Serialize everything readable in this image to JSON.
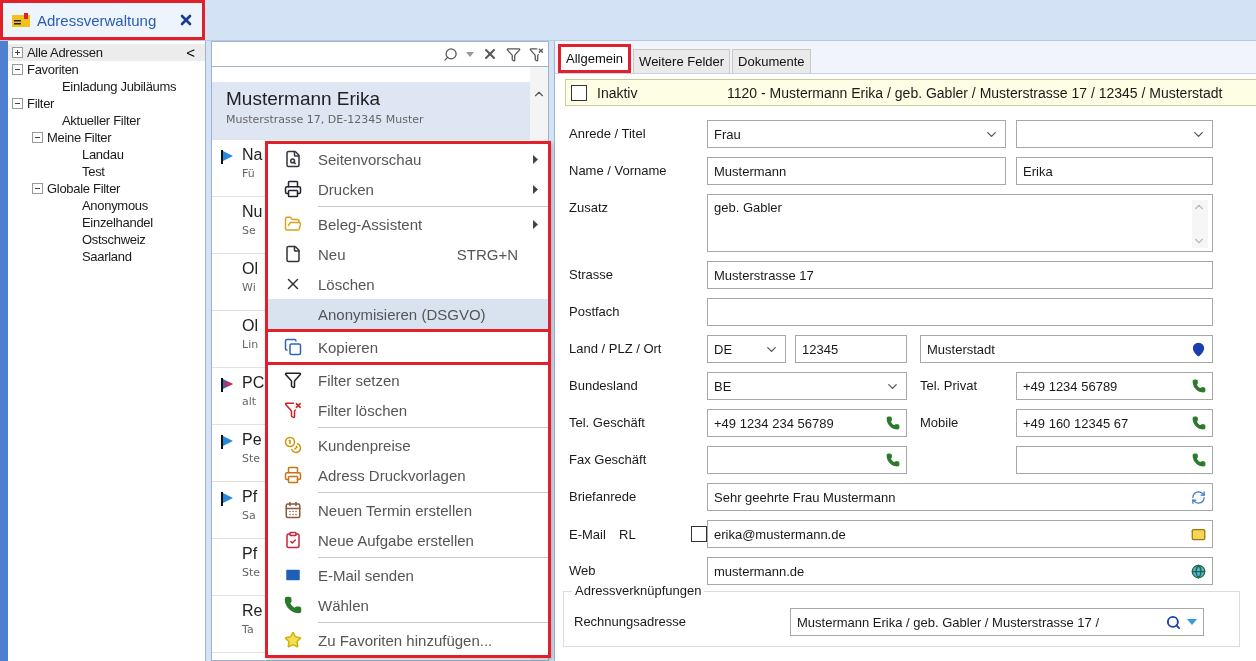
{
  "document_tab": {
    "title": "Adressverwaltung",
    "selected": true,
    "framed": true
  },
  "tree": {
    "collapse": "<",
    "items": [
      {
        "label": "Alle Adressen",
        "expanded": false,
        "selected": true
      },
      {
        "label": "Favoriten",
        "expanded": true,
        "selected": false,
        "children": [
          {
            "label": "Einladung Jubiläums",
            "selected": false
          }
        ]
      },
      {
        "label": "Filter",
        "expanded": true,
        "selected": false,
        "children": [
          {
            "label": "Aktueller Filter",
            "selected": false
          },
          {
            "label": "Meine Filter",
            "expanded": true,
            "selected": false,
            "children": [
              {
                "label": "Landau",
                "selected": false
              },
              {
                "label": "Test",
                "selected": false
              }
            ]
          },
          {
            "label": "Globale Filter",
            "expanded": true,
            "selected": false,
            "children": [
              {
                "label": "Anonymous",
                "selected": false
              },
              {
                "label": "Einzelhandel",
                "selected": false
              },
              {
                "label": "Ostschweiz",
                "selected": false
              },
              {
                "label": "Saarland",
                "selected": false
              }
            ]
          }
        ]
      }
    ]
  },
  "address_list": {
    "rows": [
      {
        "title": "Mustermann Erika",
        "subtitle": "Musterstrasse 17, DE-12345 Muster",
        "selected": true,
        "kind": "plain"
      },
      {
        "title": "Na",
        "subtitle": "Fü",
        "selected": false,
        "kind": "flagged"
      },
      {
        "title": "Nu",
        "subtitle": "Se",
        "selected": false,
        "kind": "plain"
      },
      {
        "title": "Ol",
        "subtitle": "Wi",
        "selected": false,
        "kind": "plain"
      },
      {
        "title": "Ol",
        "subtitle": "Lin",
        "selected": false,
        "kind": "plain"
      },
      {
        "title": "PC",
        "subtitle": "alt",
        "selected": false,
        "kind": "double-flagged"
      },
      {
        "title": "Pe",
        "subtitle": "Ste",
        "selected": false,
        "kind": "flagged"
      },
      {
        "title": "Pf",
        "subtitle": "Sa",
        "selected": false,
        "kind": "flagged"
      },
      {
        "title": "Pf",
        "subtitle": "Ste",
        "selected": false,
        "kind": "plain"
      },
      {
        "title": "Re",
        "subtitle": "Ta",
        "selected": false,
        "kind": "plain"
      }
    ]
  },
  "context_menu": {
    "groups": [
      {
        "framed": true,
        "items": [
          {
            "kind": "item",
            "label": "Seitenvorschau",
            "submenu": true,
            "highlighted": false
          },
          {
            "kind": "item",
            "label": "Drucken",
            "submenu": true,
            "highlighted": false
          },
          {
            "kind": "separator"
          },
          {
            "kind": "item",
            "label": "Beleg-Assistent",
            "submenu": true,
            "highlighted": false
          },
          {
            "kind": "item",
            "label": "Neu",
            "shortcut": "STRG+N",
            "submenu": false,
            "highlighted": false
          },
          {
            "kind": "item",
            "label": "Löschen",
            "submenu": false,
            "highlighted": false
          },
          {
            "kind": "item",
            "label": "Anonymisieren (DSGVO)",
            "submenu": false,
            "highlighted": true
          }
        ]
      },
      {
        "framed": true,
        "items": [
          {
            "kind": "item",
            "label": "Kopieren",
            "submenu": false,
            "highlighted": false
          }
        ]
      },
      {
        "framed": true,
        "items": [
          {
            "kind": "item",
            "label": "Filter setzen",
            "submenu": false,
            "highlighted": false
          },
          {
            "kind": "item",
            "label": "Filter löschen",
            "submenu": false,
            "highlighted": false
          },
          {
            "kind": "separator"
          },
          {
            "kind": "item",
            "label": "Kundenpreise",
            "submenu": false,
            "highlighted": false
          },
          {
            "kind": "item",
            "label": "Adress Druckvorlagen",
            "submenu": false,
            "highlighted": false
          },
          {
            "kind": "separator"
          },
          {
            "kind": "item",
            "label": "Neuen Termin erstellen",
            "submenu": false,
            "highlighted": false
          },
          {
            "kind": "item",
            "label": "Neue Aufgabe erstellen",
            "submenu": false,
            "highlighted": false
          },
          {
            "kind": "separator"
          },
          {
            "kind": "item",
            "label": "E-Mail senden",
            "submenu": false,
            "highlighted": false
          },
          {
            "kind": "item",
            "label": "Wählen",
            "submenu": false,
            "highlighted": false
          },
          {
            "kind": "separator"
          },
          {
            "kind": "item",
            "label": "Zu Favoriten hinzufügen...",
            "submenu": false,
            "highlighted": false
          }
        ]
      }
    ]
  },
  "detail": {
    "tabs": [
      {
        "label": "Allgemein",
        "selected": true,
        "framed": true
      },
      {
        "label": "Weitere Felder",
        "selected": false,
        "framed": false
      },
      {
        "label": "Dokumente",
        "selected": false,
        "framed": false
      }
    ],
    "header": {
      "inactive": {
        "label": "Inaktiv",
        "checked": false
      },
      "summary": "1120 - Mustermann Erika / geb. Gabler / Musterstrasse 17 / 12345 / Musterstadt"
    },
    "rows": [
      {
        "label": "Anrede / Titel",
        "fields": [
          {
            "kind": "combo",
            "value": "Frau"
          },
          {
            "kind": "combo"
          }
        ]
      },
      {
        "label": "Name / Vorname",
        "fields": [
          {
            "kind": "text",
            "value": "Mustermann"
          },
          {
            "kind": "text",
            "value": "Erika"
          }
        ]
      },
      {
        "label": "Zusatz",
        "fields": [
          {
            "kind": "memo",
            "value": "geb. Gabler"
          }
        ]
      },
      {
        "label": "Strasse",
        "fields": [
          {
            "kind": "text",
            "value": "Musterstrasse 17"
          }
        ]
      },
      {
        "label": "Postfach",
        "fields": [
          {
            "kind": "text"
          }
        ]
      },
      {
        "label": "Land / PLZ / Ort",
        "fields": [
          {
            "kind": "combo",
            "value": "DE"
          },
          {
            "kind": "text",
            "value": "12345"
          },
          {
            "kind": "location",
            "value": "Musterstadt"
          }
        ]
      },
      {
        "label": "Bundesland",
        "fields": [
          {
            "kind": "combo",
            "value": "BE"
          }
        ],
        "secondary": {
          "label": "Tel. Privat",
          "fields": [
            {
              "kind": "phone",
              "value": "+49 1234 56789"
            }
          ]
        }
      },
      {
        "label": "Tel. Geschäft",
        "fields": [
          {
            "kind": "phone",
            "value": "+49 1234 234 56789"
          }
        ],
        "secondary": {
          "label": "Mobile",
          "fields": [
            {
              "kind": "phone",
              "value": "+49 160 12345 67"
            }
          ]
        }
      },
      {
        "label": "Fax Geschäft",
        "fields": [
          {
            "kind": "phone"
          }
        ],
        "secondary": {
          "fields": [
            {
              "kind": "phone"
            }
          ]
        }
      },
      {
        "label": "Briefanrede",
        "fields": [
          {
            "kind": "salutation",
            "value": "Sehr geehrte Frau Mustermann"
          }
        ]
      },
      {
        "label": "E-Mail",
        "sublabel": "RL",
        "checkbox": {
          "checked": false
        },
        "fields": [
          {
            "kind": "email",
            "value": "erika@mustermann.de"
          }
        ]
      },
      {
        "label": "Web",
        "fields": [
          {
            "kind": "web",
            "value": "mustermann.de"
          }
        ]
      }
    ],
    "links": {
      "title": "Adressverknüpfungen",
      "rows": [
        {
          "label": "Rechnungsadresse",
          "fields": [
            {
              "kind": "lookup",
              "value": "Mustermann Erika / geb. Gabler / Musterstrasse 17 /"
            }
          ]
        }
      ]
    }
  }
}
